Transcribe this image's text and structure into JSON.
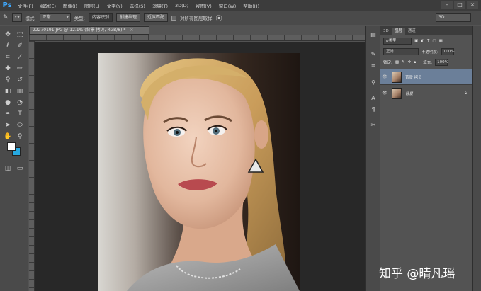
{
  "menu": {
    "logo": "Ps",
    "items": [
      "文件(F)",
      "编辑(E)",
      "图像(I)",
      "图层(L)",
      "文字(Y)",
      "选择(S)",
      "滤镜(T)",
      "3D(D)",
      "视图(V)",
      "窗口(W)",
      "帮助(H)"
    ],
    "window_controls": [
      "–",
      "□",
      "×"
    ]
  },
  "options": {
    "mode_label": "模式:",
    "mode_value": "正常",
    "type_label": "类型:",
    "type_buttons": [
      "内容识别",
      "创建纹理",
      "近似匹配"
    ],
    "sample_all_label": "对所有图层取样",
    "workspace_value": "3D"
  },
  "document": {
    "tab_title": "22270191.JPG @ 12.1% (背景 拷贝, RGB/8) *",
    "tab_close": "×"
  },
  "colors": {
    "foreground": "#ffffff",
    "background": "#27a9e1",
    "selection": "#6b7f99"
  },
  "layers_panel": {
    "tabs": [
      "3D",
      "图层",
      "通道"
    ],
    "active_tab": "图层",
    "kind_value": "ρ类型",
    "blend_mode": "正常",
    "opacity_label": "不透明度:",
    "opacity_value": "100%",
    "lock_label": "锁定:",
    "fill_label": "填充:",
    "fill_value": "100%",
    "layers": [
      {
        "name": "背景 拷贝",
        "selected": true,
        "locked": false
      },
      {
        "name": "背景",
        "selected": false,
        "locked": true
      }
    ]
  },
  "watermark": "知乎 @晴凡瑶"
}
